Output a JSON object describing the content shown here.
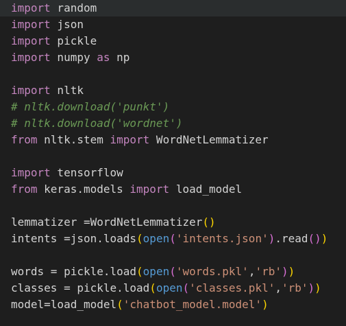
{
  "colors": {
    "background": "#1e1e1e",
    "current_line": "#2a2d2e",
    "keyword": "#c586c0",
    "text": "#d4d4d4",
    "string": "#ce9178",
    "builtin": "#569cd6",
    "comment": "#6a9955",
    "bracket_level_1": "#ffd700",
    "bracket_level_2": "#da70d6",
    "bracket_level_3": "#179fff"
  },
  "lines": [
    [
      [
        "keyword",
        "import"
      ],
      [
        "plain",
        " random"
      ]
    ],
    [
      [
        "keyword",
        "import"
      ],
      [
        "plain",
        " json"
      ]
    ],
    [
      [
        "keyword",
        "import"
      ],
      [
        "plain",
        " pickle"
      ]
    ],
    [
      [
        "keyword",
        "import"
      ],
      [
        "plain",
        " numpy "
      ],
      [
        "keyword",
        "as"
      ],
      [
        "plain",
        " np"
      ]
    ],
    [],
    [
      [
        "keyword",
        "import"
      ],
      [
        "plain",
        " nltk"
      ]
    ],
    [
      [
        "comment",
        "# nltk.download('punkt')"
      ]
    ],
    [
      [
        "comment",
        "# nltk.download('wordnet')"
      ]
    ],
    [
      [
        "keyword",
        "from"
      ],
      [
        "plain",
        " nltk.stem "
      ],
      [
        "keyword",
        "import"
      ],
      [
        "plain",
        " WordNetLemmatizer"
      ]
    ],
    [],
    [
      [
        "keyword",
        "import"
      ],
      [
        "plain",
        " tensorflow"
      ]
    ],
    [
      [
        "keyword",
        "from"
      ],
      [
        "plain",
        " keras.models "
      ],
      [
        "keyword",
        "import"
      ],
      [
        "plain",
        " load_model"
      ]
    ],
    [],
    [
      [
        "plain",
        "lemmatizer =WordNetLemmatizer"
      ],
      [
        "paren1",
        "()"
      ]
    ],
    [
      [
        "plain",
        "intents =json.loads"
      ],
      [
        "paren1",
        "("
      ],
      [
        "builtin",
        "open"
      ],
      [
        "paren2",
        "("
      ],
      [
        "string",
        "'intents.json'"
      ],
      [
        "paren2",
        ")"
      ],
      [
        "plain",
        ".read"
      ],
      [
        "paren2",
        "()"
      ],
      [
        "paren1",
        ")"
      ]
    ],
    [],
    [
      [
        "plain",
        "words = pickle.load"
      ],
      [
        "paren1",
        "("
      ],
      [
        "builtin",
        "open"
      ],
      [
        "paren2",
        "("
      ],
      [
        "string",
        "'words.pkl'"
      ],
      [
        "plain",
        ","
      ],
      [
        "string",
        "'rb'"
      ],
      [
        "paren2",
        ")"
      ],
      [
        "paren1",
        ")"
      ]
    ],
    [
      [
        "plain",
        "classes = pickle.load"
      ],
      [
        "paren1",
        "("
      ],
      [
        "builtin",
        "open"
      ],
      [
        "paren2",
        "("
      ],
      [
        "string",
        "'classes.pkl'"
      ],
      [
        "plain",
        ","
      ],
      [
        "string",
        "'rb'"
      ],
      [
        "paren2",
        ")"
      ],
      [
        "paren1",
        ")"
      ]
    ],
    [
      [
        "plain",
        "model=load_model"
      ],
      [
        "paren1",
        "("
      ],
      [
        "string",
        "'chatbot_model.model'"
      ],
      [
        "paren1",
        ")"
      ]
    ]
  ]
}
